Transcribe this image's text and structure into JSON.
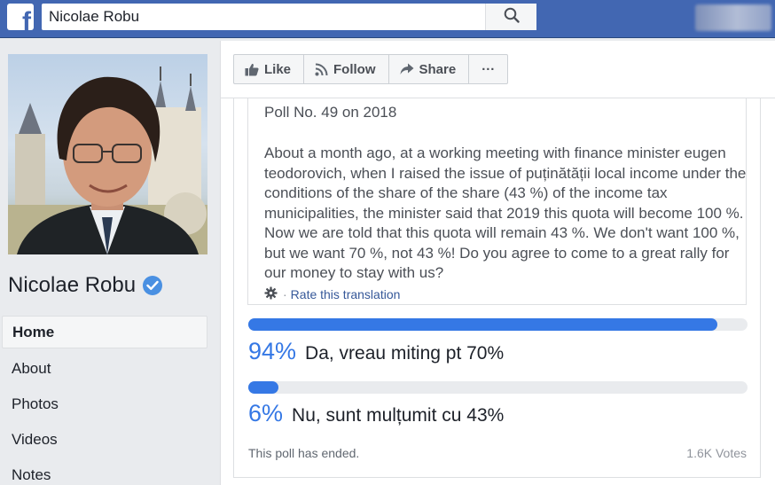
{
  "topbar": {
    "logo": "f",
    "search_value": "Nicolae Robu",
    "search_icon": "search-icon"
  },
  "page": {
    "name": "Nicolae Robu",
    "verified_icon": "verified-badge-icon"
  },
  "nav": {
    "items": [
      {
        "label": "Home"
      },
      {
        "label": "About"
      },
      {
        "label": "Photos"
      },
      {
        "label": "Videos"
      },
      {
        "label": "Notes"
      }
    ]
  },
  "actions": {
    "like": "Like",
    "follow": "Follow",
    "share": "Share",
    "more": "···"
  },
  "post": {
    "poll_title": "Poll No. 49 on 2018",
    "text": "About a month ago, at a working meeting with finance minister eugen teodorovich, when I raised the issue of puținătății local income under the conditions of the share of the share (43 %) of the income tax municipalities, the minister said that 2019 this quota will become 100 %. Now we are told that this quota will remain 43 %. We don't want 100 %, but we want 70 %, not 43 %! Do you agree to come to a great rally for our money to stay with us?",
    "rate_translation": "Rate this translation",
    "rate_separator": "·",
    "options": [
      {
        "pct": "94%",
        "value": 0.94,
        "label": "Da, vreau miting pt 70%"
      },
      {
        "pct": "6%",
        "value": 0.06,
        "label": "Nu, sunt mulțumit cu 43%"
      }
    ],
    "status": "This poll has ended.",
    "votes": "1.6K Votes"
  },
  "colors": {
    "brand": "#4267b2",
    "poll_bar": "#3578e5",
    "link": "#365899"
  }
}
